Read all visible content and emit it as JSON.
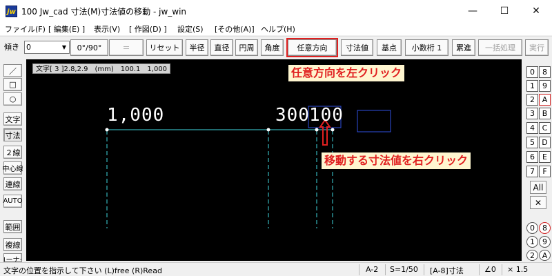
{
  "window": {
    "title": "100 Jw_cad 寸法(M)寸法値の移動 - jw_win",
    "app_icon": "jw",
    "minimize": "—",
    "maximize": "☐",
    "close": "✕"
  },
  "menu": [
    "ファイル(F)",
    "[ 編集(E) ]",
    "表示(V)",
    "[ 作図(D) ]",
    "設定(S)",
    "[その他(A)]",
    "ヘルプ(H)"
  ],
  "toolbar": {
    "angle_label": "傾き",
    "angle_value": "0",
    "angle_drop": "▼",
    "buttons": {
      "angle90": "0°/90°",
      "equal": "＝",
      "reset": "リセット",
      "radius": "半径",
      "diameter": "直径",
      "circumference": "円周",
      "angle": "角度",
      "arbitrary": "任意方向",
      "dimvalue": "寸法値",
      "basepoint": "基点",
      "decimals": "小数桁 1",
      "cumulative": "累進",
      "batch": "一括処理",
      "execute": "実行"
    }
  },
  "left_tools": [
    "／",
    "□",
    "○",
    "文字",
    "寸法",
    "２線",
    "中心線",
    "連線",
    "AUTO",
    "範囲",
    "複線",
    "コーナー"
  ],
  "canvas": {
    "readout": "文字[ 3 ]2.8,2.9　(mm)　100.1　1,000",
    "callout_left_click": "任意方向を左クリック",
    "callout_right_click": "移動する寸法値を右クリック",
    "dim_text_1": "1,000",
    "dim_text_2": "300",
    "dim_text_3": "100",
    "colors": {
      "background": "#000000",
      "dim_line": "#40d8e0",
      "selection": "#3050e0",
      "callout_text": "#e02020",
      "callout_bg": "#fff6d0",
      "arrow": "#e02020"
    }
  },
  "right_tools": {
    "layer_groups_top": [
      [
        "0",
        "8"
      ],
      [
        "1",
        "9"
      ],
      [
        "2",
        "A"
      ],
      [
        "3",
        "B"
      ],
      [
        "4",
        "C"
      ],
      [
        "5",
        "D"
      ],
      [
        "6",
        "E"
      ],
      [
        "7",
        "F"
      ]
    ],
    "all": "All",
    "cross": "✕",
    "layers_bottom": [
      [
        "0",
        "8"
      ],
      [
        "1",
        "9"
      ],
      [
        "2",
        "A"
      ]
    ]
  },
  "status": {
    "prompt": "文字の位置を指示して下さい (L)free (R)Read",
    "layer": "A-2",
    "scale": "S=1/50",
    "current_layer": "[A-8]寸法",
    "angle": "∠0",
    "zoom": "× 1.5"
  }
}
